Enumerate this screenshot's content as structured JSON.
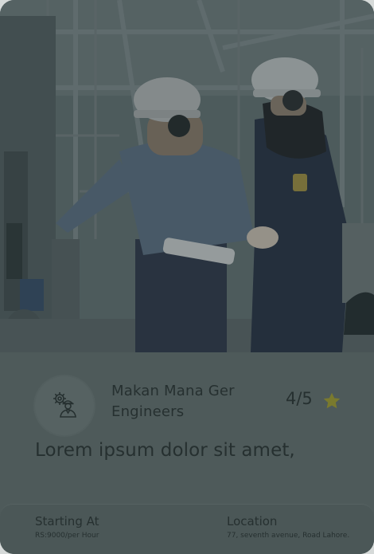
{
  "company": {
    "name": "Makan Mana Ger Engineers",
    "icon": "engineer-gear-icon"
  },
  "rating": {
    "text": "4/5",
    "value": 4,
    "max": 5,
    "star_color": "#7a7a2e"
  },
  "tagline": "Lorem ipsum dolor sit amet,",
  "footer": {
    "starting_at_label": "Starting At",
    "starting_at_value": "RS:9000/per Hour",
    "location_label": "Location",
    "location_value": "77, seventh avenue, Road Lahore."
  },
  "colors": {
    "overlay": "#4e5a5a",
    "text": "#263030"
  }
}
